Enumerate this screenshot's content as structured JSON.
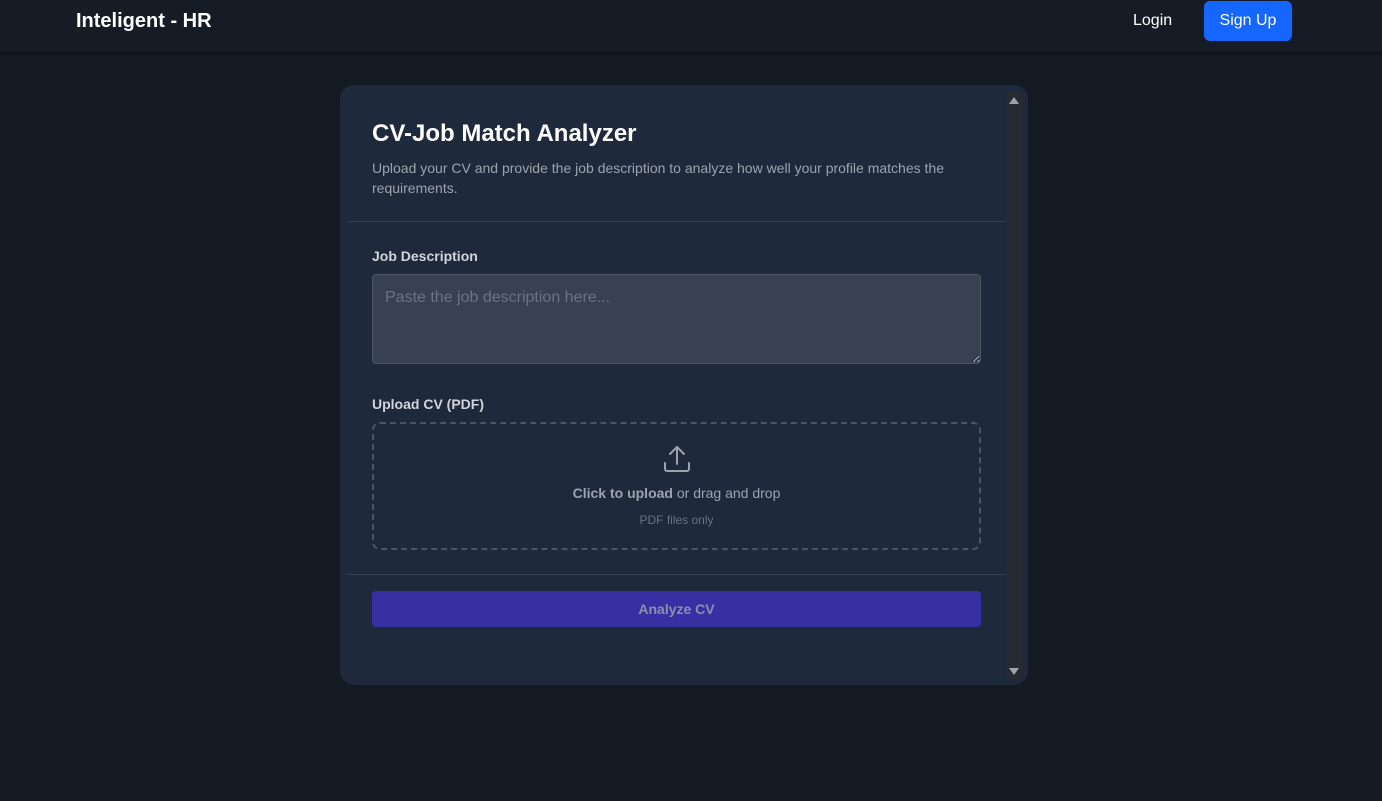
{
  "navbar": {
    "brand": "Inteligent - HR",
    "login_label": "Login",
    "signup_label": "Sign Up"
  },
  "card": {
    "title": "CV-Job Match Analyzer",
    "subtitle": "Upload your CV and provide the job description to analyze how well your profile matches the requirements.",
    "job_description": {
      "label": "Job Description",
      "placeholder": "Paste the job description here...",
      "value": ""
    },
    "upload": {
      "label": "Upload CV (PDF)",
      "icon": "upload-icon",
      "click_text": "Click to upload",
      "drag_text": " or drag and drop",
      "hint": "PDF files only"
    },
    "analyze_label": "Analyze CV"
  },
  "colors": {
    "background": "#141a22",
    "navbar": "#161c25",
    "card": "#1e293b",
    "primary_button": "#1466ff",
    "analyze_button": "#3730a3"
  }
}
